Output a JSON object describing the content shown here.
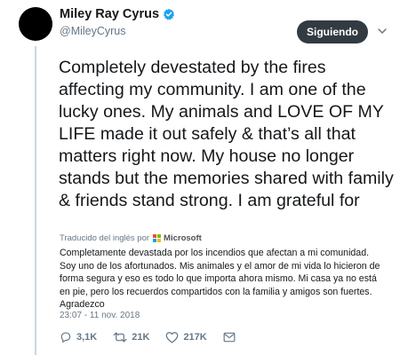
{
  "user": {
    "name": "Miley Ray Cyrus",
    "handle": "@MileyCyrus",
    "verified": true,
    "avatar_color": "#000000"
  },
  "follow_button": {
    "label": "Siguiendo",
    "bg": "#333b42"
  },
  "menu": {
    "icon": "chevron-down-icon"
  },
  "tweet": {
    "text": "Completely devestated by the fires affecting my community. I am one of the lucky ones. My animals and LOVE OF MY LIFE made it out safely & that’s all that matters right now. My house no longer stands but the memories shared with family & friends stand strong. I am grateful for"
  },
  "translation": {
    "label": "Traducido del inglés por",
    "provider": "Microsoft",
    "text": "Completamente devastada por los incendios que afectan a mi comunidad. Soy uno de los afortunados. Mis animales y el amor de mi vida lo hicieron de forma segura y eso es todo lo que importa ahora mismo. Mi casa ya no está en pie, pero los recuerdos compartidos con la familia y amigos son fuertes. Agradezco"
  },
  "timestamp": "23:07 - 11 nov. 2018",
  "actions": {
    "replies": "3,1K",
    "retweets": "21K",
    "likes": "217K"
  },
  "colors": {
    "verified": "#1da1f2",
    "secondary_text": "#657786",
    "thread_line": "#ccd6dd"
  }
}
